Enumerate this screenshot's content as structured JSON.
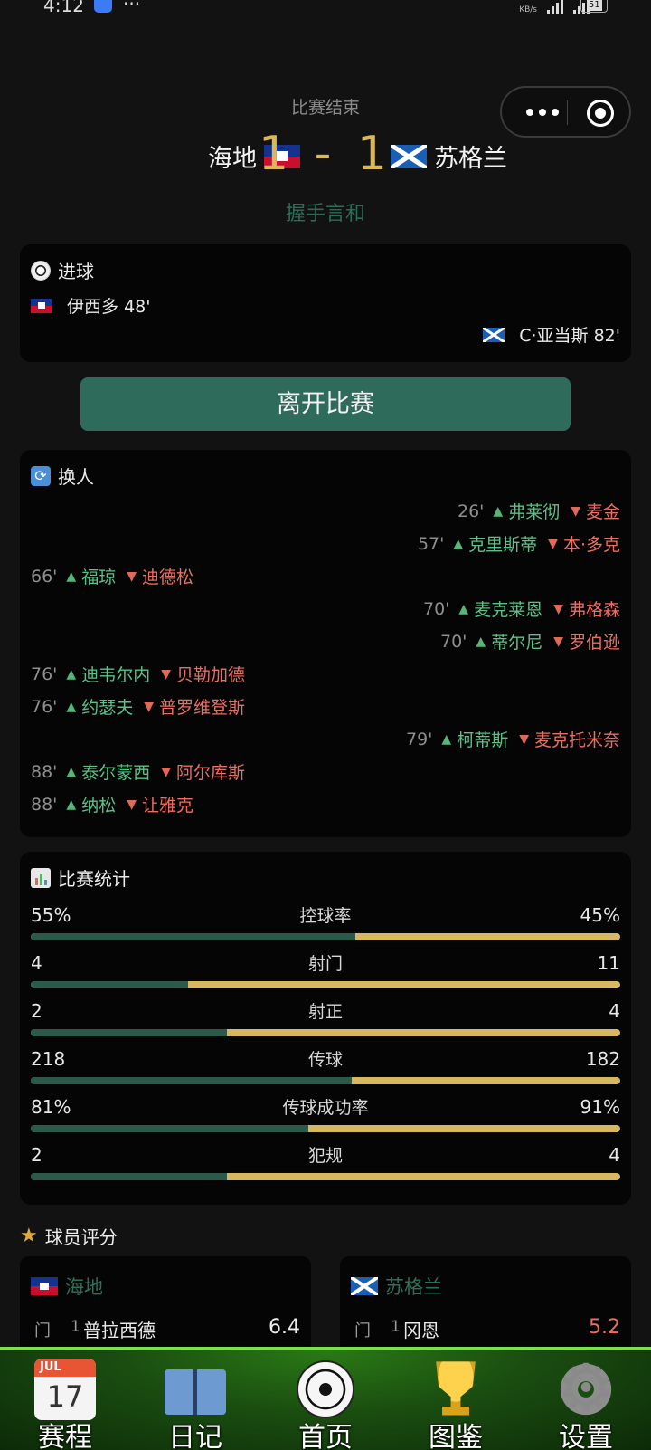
{
  "status_bar": {
    "time": "4:12",
    "net_speed": "KB/s",
    "battery": "51"
  },
  "header": {
    "match_status": "比赛结束",
    "home_team": "海地",
    "away_team": "苏格兰",
    "score": "1 - 1",
    "result": "握手言和"
  },
  "goals": {
    "title": "进球",
    "home": [
      {
        "player": "伊西多",
        "minute": "48'"
      }
    ],
    "away": [
      {
        "player": "C·亚当斯",
        "minute": "82'"
      }
    ]
  },
  "leave_button": "离开比赛",
  "substitutions": {
    "title": "换人",
    "rows": [
      {
        "side": "away",
        "minute": "26'",
        "in": "弗莱彻",
        "out": "麦金"
      },
      {
        "side": "away",
        "minute": "57'",
        "in": "克里斯蒂",
        "out": "本·多克"
      },
      {
        "side": "home",
        "minute": "66'",
        "in": "福琼",
        "out": "迪德松"
      },
      {
        "side": "away",
        "minute": "70'",
        "in": "麦克莱恩",
        "out": "弗格森"
      },
      {
        "side": "away",
        "minute": "70'",
        "in": "蒂尔尼",
        "out": "罗伯逊"
      },
      {
        "side": "home",
        "minute": "76'",
        "in": "迪韦尔内",
        "out": "贝勒加德"
      },
      {
        "side": "home",
        "minute": "76'",
        "in": "约瑟夫",
        "out": "普罗维登斯"
      },
      {
        "side": "away",
        "minute": "79'",
        "in": "柯蒂斯",
        "out": "麦克托米奈"
      },
      {
        "side": "home",
        "minute": "88'",
        "in": "泰尔蒙西",
        "out": "阿尔库斯"
      },
      {
        "side": "home",
        "minute": "88'",
        "in": "纳松",
        "out": "让雅克"
      }
    ]
  },
  "stats": {
    "title": "比赛统计",
    "rows": [
      {
        "name": "控球率",
        "home": "55%",
        "away": "45%",
        "home_share": 0.55
      },
      {
        "name": "射门",
        "home": "4",
        "away": "11",
        "home_share": 0.267
      },
      {
        "name": "射正",
        "home": "2",
        "away": "4",
        "home_share": 0.333
      },
      {
        "name": "传球",
        "home": "218",
        "away": "182",
        "home_share": 0.545
      },
      {
        "name": "传球成功率",
        "home": "81%",
        "away": "91%",
        "home_share": 0.471
      },
      {
        "name": "犯规",
        "home": "2",
        "away": "4",
        "home_share": 0.333
      }
    ]
  },
  "ratings": {
    "title": "球员评分",
    "home": {
      "team": "海地",
      "players": [
        {
          "pos": "门",
          "number": "1",
          "name": "普拉西德",
          "rating": "6.4"
        }
      ]
    },
    "away": {
      "team": "苏格兰",
      "players": [
        {
          "pos": "门",
          "number": "1",
          "name": "冈恩",
          "rating": "5.2"
        }
      ]
    }
  },
  "tabbar": [
    {
      "label": "赛程",
      "icon": "calendar-icon",
      "calendar_month": "JUL",
      "calendar_day": "17"
    },
    {
      "label": "日记",
      "icon": "book-icon"
    },
    {
      "label": "首页",
      "icon": "soccer-ball-icon"
    },
    {
      "label": "图鉴",
      "icon": "trophy-icon"
    },
    {
      "label": "设置",
      "icon": "gear-icon"
    }
  ],
  "colors": {
    "accent_green": "#2e6b5a",
    "score_gold": "#d9b85a",
    "sub_in": "#5cc088",
    "sub_out": "#e96f62",
    "rating_low": "#e96f62"
  }
}
